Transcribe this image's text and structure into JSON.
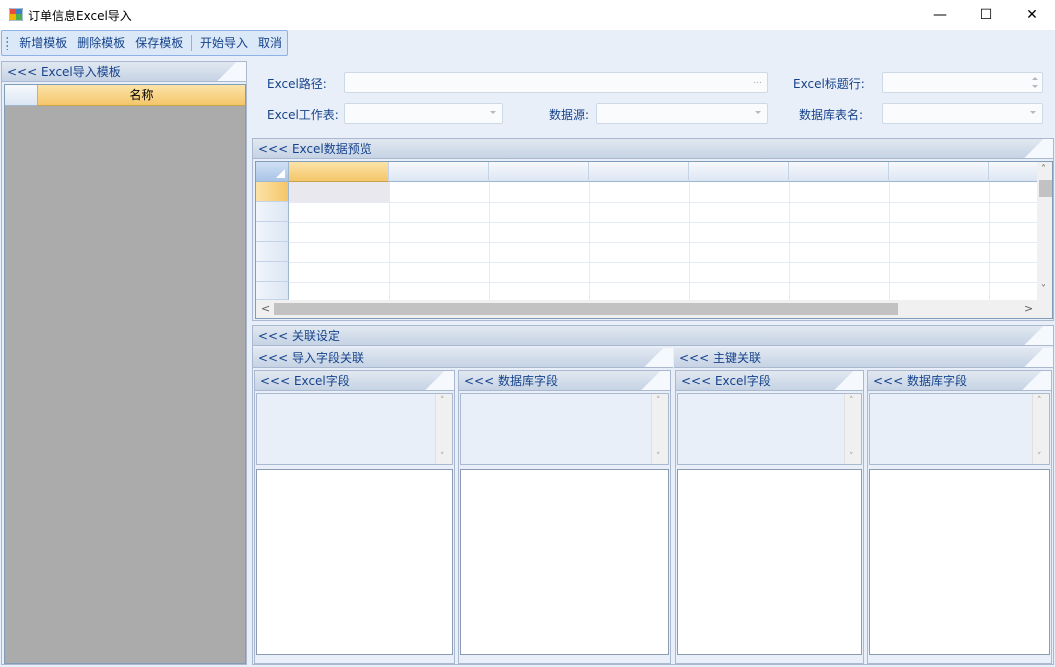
{
  "window": {
    "title": "订单信息Excel导入",
    "minimize_glyph": "—",
    "maximize_glyph": "☐",
    "close_glyph": "✕"
  },
  "toolbar": {
    "add_template": "新增模板",
    "delete_template": "删除模板",
    "save_template": "保存模板",
    "start_import": "开始导入",
    "cancel": "取消"
  },
  "left_panel": {
    "header": "<<< Excel导入模板",
    "grid": {
      "columns": [
        "名称"
      ],
      "rows": []
    }
  },
  "form": {
    "excel_path_label": "Excel路径:",
    "excel_path_value": "",
    "excel_path_button": "...",
    "excel_title_row_label": "Excel标题行:",
    "excel_title_row_value": "",
    "excel_sheet_label": "Excel工作表:",
    "excel_sheet_value": "",
    "datasource_label": "数据源:",
    "datasource_value": "",
    "db_table_label": "数据库表名:",
    "db_table_value": ""
  },
  "preview": {
    "header": "<<< Excel数据预览",
    "columns": [
      "",
      "",
      "",
      "",
      "",
      "",
      ""
    ],
    "rows": [
      [
        "",
        "",
        "",
        "",
        "",
        "",
        ""
      ],
      [
        "",
        "",
        "",
        "",
        "",
        "",
        ""
      ],
      [
        "",
        "",
        "",
        "",
        "",
        "",
        ""
      ],
      [
        "",
        "",
        "",
        "",
        "",
        "",
        ""
      ],
      [
        "",
        "",
        "",
        "",
        "",
        "",
        ""
      ],
      [
        "",
        "",
        "",
        "",
        "",
        "",
        ""
      ]
    ]
  },
  "relation": {
    "header": "<<< 关联设定",
    "field_mapping": {
      "header": "<<< 导入字段关联",
      "excel_field_header": "<<< Excel字段",
      "db_field_header": "<<< 数据库字段"
    },
    "primary_key": {
      "header": "<<< 主键关联",
      "excel_field_header": "<<< Excel字段",
      "db_field_header": "<<< 数据库字段"
    }
  },
  "icons": {
    "scroll_up": "˄",
    "scroll_down": "˅",
    "scroll_left": "<",
    "scroll_right": ">"
  },
  "colors": {
    "accent_header": "#15428b",
    "selected_column": "#f5c66a",
    "panel_background": "#e9eff8",
    "grid_empty": "#ababab"
  }
}
